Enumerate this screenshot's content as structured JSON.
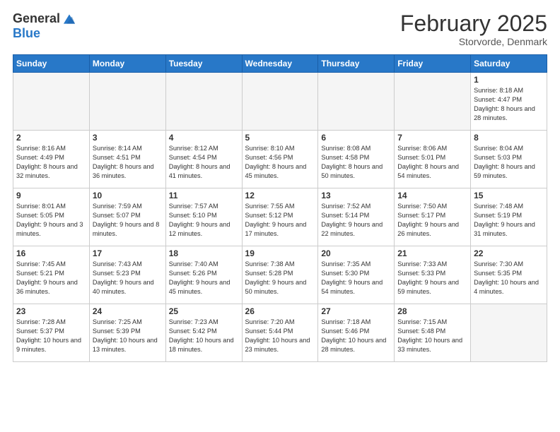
{
  "header": {
    "logo_general": "General",
    "logo_blue": "Blue",
    "month_title": "February 2025",
    "subtitle": "Storvorde, Denmark"
  },
  "days_of_week": [
    "Sunday",
    "Monday",
    "Tuesday",
    "Wednesday",
    "Thursday",
    "Friday",
    "Saturday"
  ],
  "weeks": [
    [
      {
        "day": "",
        "info": ""
      },
      {
        "day": "",
        "info": ""
      },
      {
        "day": "",
        "info": ""
      },
      {
        "day": "",
        "info": ""
      },
      {
        "day": "",
        "info": ""
      },
      {
        "day": "",
        "info": ""
      },
      {
        "day": "1",
        "info": "Sunrise: 8:18 AM\nSunset: 4:47 PM\nDaylight: 8 hours and 28 minutes."
      }
    ],
    [
      {
        "day": "2",
        "info": "Sunrise: 8:16 AM\nSunset: 4:49 PM\nDaylight: 8 hours and 32 minutes."
      },
      {
        "day": "3",
        "info": "Sunrise: 8:14 AM\nSunset: 4:51 PM\nDaylight: 8 hours and 36 minutes."
      },
      {
        "day": "4",
        "info": "Sunrise: 8:12 AM\nSunset: 4:54 PM\nDaylight: 8 hours and 41 minutes."
      },
      {
        "day": "5",
        "info": "Sunrise: 8:10 AM\nSunset: 4:56 PM\nDaylight: 8 hours and 45 minutes."
      },
      {
        "day": "6",
        "info": "Sunrise: 8:08 AM\nSunset: 4:58 PM\nDaylight: 8 hours and 50 minutes."
      },
      {
        "day": "7",
        "info": "Sunrise: 8:06 AM\nSunset: 5:01 PM\nDaylight: 8 hours and 54 minutes."
      },
      {
        "day": "8",
        "info": "Sunrise: 8:04 AM\nSunset: 5:03 PM\nDaylight: 8 hours and 59 minutes."
      }
    ],
    [
      {
        "day": "9",
        "info": "Sunrise: 8:01 AM\nSunset: 5:05 PM\nDaylight: 9 hours and 3 minutes."
      },
      {
        "day": "10",
        "info": "Sunrise: 7:59 AM\nSunset: 5:07 PM\nDaylight: 9 hours and 8 minutes."
      },
      {
        "day": "11",
        "info": "Sunrise: 7:57 AM\nSunset: 5:10 PM\nDaylight: 9 hours and 12 minutes."
      },
      {
        "day": "12",
        "info": "Sunrise: 7:55 AM\nSunset: 5:12 PM\nDaylight: 9 hours and 17 minutes."
      },
      {
        "day": "13",
        "info": "Sunrise: 7:52 AM\nSunset: 5:14 PM\nDaylight: 9 hours and 22 minutes."
      },
      {
        "day": "14",
        "info": "Sunrise: 7:50 AM\nSunset: 5:17 PM\nDaylight: 9 hours and 26 minutes."
      },
      {
        "day": "15",
        "info": "Sunrise: 7:48 AM\nSunset: 5:19 PM\nDaylight: 9 hours and 31 minutes."
      }
    ],
    [
      {
        "day": "16",
        "info": "Sunrise: 7:45 AM\nSunset: 5:21 PM\nDaylight: 9 hours and 36 minutes."
      },
      {
        "day": "17",
        "info": "Sunrise: 7:43 AM\nSunset: 5:23 PM\nDaylight: 9 hours and 40 minutes."
      },
      {
        "day": "18",
        "info": "Sunrise: 7:40 AM\nSunset: 5:26 PM\nDaylight: 9 hours and 45 minutes."
      },
      {
        "day": "19",
        "info": "Sunrise: 7:38 AM\nSunset: 5:28 PM\nDaylight: 9 hours and 50 minutes."
      },
      {
        "day": "20",
        "info": "Sunrise: 7:35 AM\nSunset: 5:30 PM\nDaylight: 9 hours and 54 minutes."
      },
      {
        "day": "21",
        "info": "Sunrise: 7:33 AM\nSunset: 5:33 PM\nDaylight: 9 hours and 59 minutes."
      },
      {
        "day": "22",
        "info": "Sunrise: 7:30 AM\nSunset: 5:35 PM\nDaylight: 10 hours and 4 minutes."
      }
    ],
    [
      {
        "day": "23",
        "info": "Sunrise: 7:28 AM\nSunset: 5:37 PM\nDaylight: 10 hours and 9 minutes."
      },
      {
        "day": "24",
        "info": "Sunrise: 7:25 AM\nSunset: 5:39 PM\nDaylight: 10 hours and 13 minutes."
      },
      {
        "day": "25",
        "info": "Sunrise: 7:23 AM\nSunset: 5:42 PM\nDaylight: 10 hours and 18 minutes."
      },
      {
        "day": "26",
        "info": "Sunrise: 7:20 AM\nSunset: 5:44 PM\nDaylight: 10 hours and 23 minutes."
      },
      {
        "day": "27",
        "info": "Sunrise: 7:18 AM\nSunset: 5:46 PM\nDaylight: 10 hours and 28 minutes."
      },
      {
        "day": "28",
        "info": "Sunrise: 7:15 AM\nSunset: 5:48 PM\nDaylight: 10 hours and 33 minutes."
      },
      {
        "day": "",
        "info": ""
      }
    ]
  ]
}
